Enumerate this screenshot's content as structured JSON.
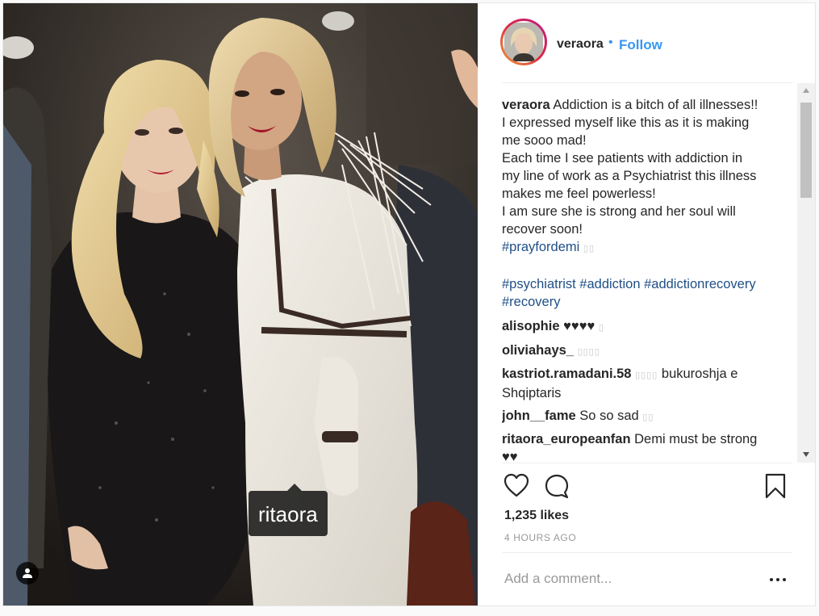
{
  "post": {
    "username": "veraora",
    "follow_separator": "•",
    "follow_label": "Follow",
    "photo_tag": "ritaora",
    "caption": {
      "username": "veraora",
      "lines": [
        "Addiction is a bitch of all illnesses!!",
        "I expressed myself like this as it is making",
        "me sooo mad!",
        "Each time I see patients with addiction in",
        "my line of work as a Psychiatrist this illness",
        "makes me feel powerless!",
        "I am sure she is strong and her soul will",
        "recover soon!"
      ],
      "hashtag_main": "#prayfordemi",
      "hashtags_line1": "#psychiatrist #addiction #addictionrecovery",
      "hashtags_line2": "#recovery"
    },
    "comments": [
      {
        "user": "alisophie",
        "text": "♥♥♥♥"
      },
      {
        "user": "oliviahays_",
        "text": ""
      },
      {
        "user": "kastriot.ramadani.58",
        "text": "bukuroshja e",
        "text2": "Shqiptaris"
      },
      {
        "user": "john__fame",
        "text": "So so sad"
      },
      {
        "user": "ritaora_europeanfan",
        "text": "Demi must be strong",
        "text2": "♥♥"
      }
    ],
    "likes": "1,235 likes",
    "time": "4 HOURS AGO",
    "comment_placeholder": "Add a comment...",
    "icons": {
      "like": "heart-icon",
      "comment": "speech-bubble-icon",
      "save": "bookmark-icon",
      "more": "ellipsis-icon",
      "user_tags": "person-icon"
    },
    "colors": {
      "follow_blue": "#3897f0",
      "hashtag": "#1f4f86",
      "muted": "#999999"
    }
  }
}
